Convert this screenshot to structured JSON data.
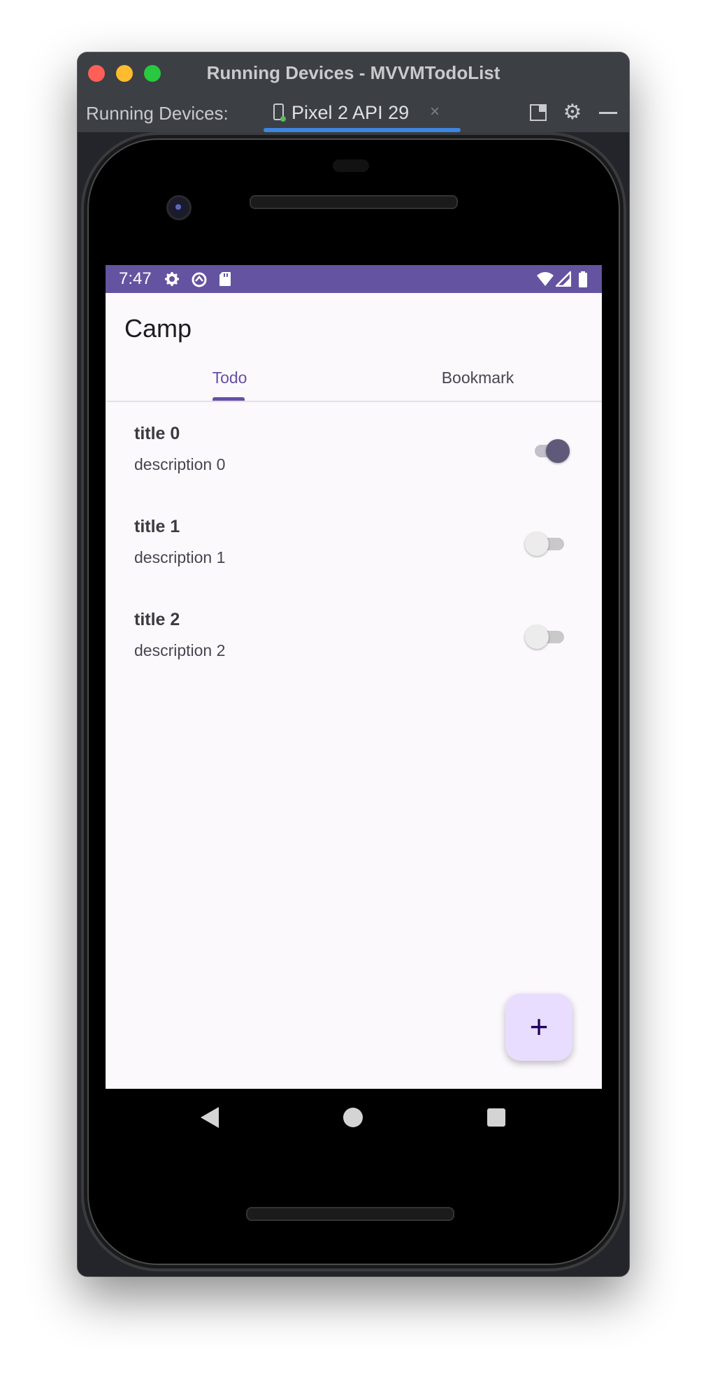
{
  "window": {
    "title": "Running Devices - MVVMTodoList"
  },
  "toolbar": {
    "label": "Running Devices:",
    "device_tab": "Pixel 2 API 29",
    "close_glyph": "×",
    "settings_glyph": "⚙",
    "icons": [
      "layout-icon",
      "gear-icon",
      "minimize-icon"
    ]
  },
  "status_bar": {
    "time": "7:47",
    "icons": [
      "settings-icon",
      "data-saver-icon",
      "sd-card-icon",
      "wifi-icon",
      "signal-icon",
      "battery-icon"
    ],
    "color": "#6453a0"
  },
  "app": {
    "title": "Camp",
    "accent": "#6650a4",
    "tabs": [
      {
        "label": "Todo",
        "selected": true
      },
      {
        "label": "Bookmark",
        "selected": false
      }
    ],
    "items": [
      {
        "title": "title 0",
        "description": "description 0",
        "toggled": true
      },
      {
        "title": "title 1",
        "description": "description 1",
        "toggled": false
      },
      {
        "title": "title 2",
        "description": "description 2",
        "toggled": false
      }
    ],
    "fab": {
      "glyph": "+",
      "color": "#e8ddff"
    }
  },
  "nav_bar": {
    "buttons": [
      "back-button",
      "home-button",
      "recents-button"
    ]
  }
}
